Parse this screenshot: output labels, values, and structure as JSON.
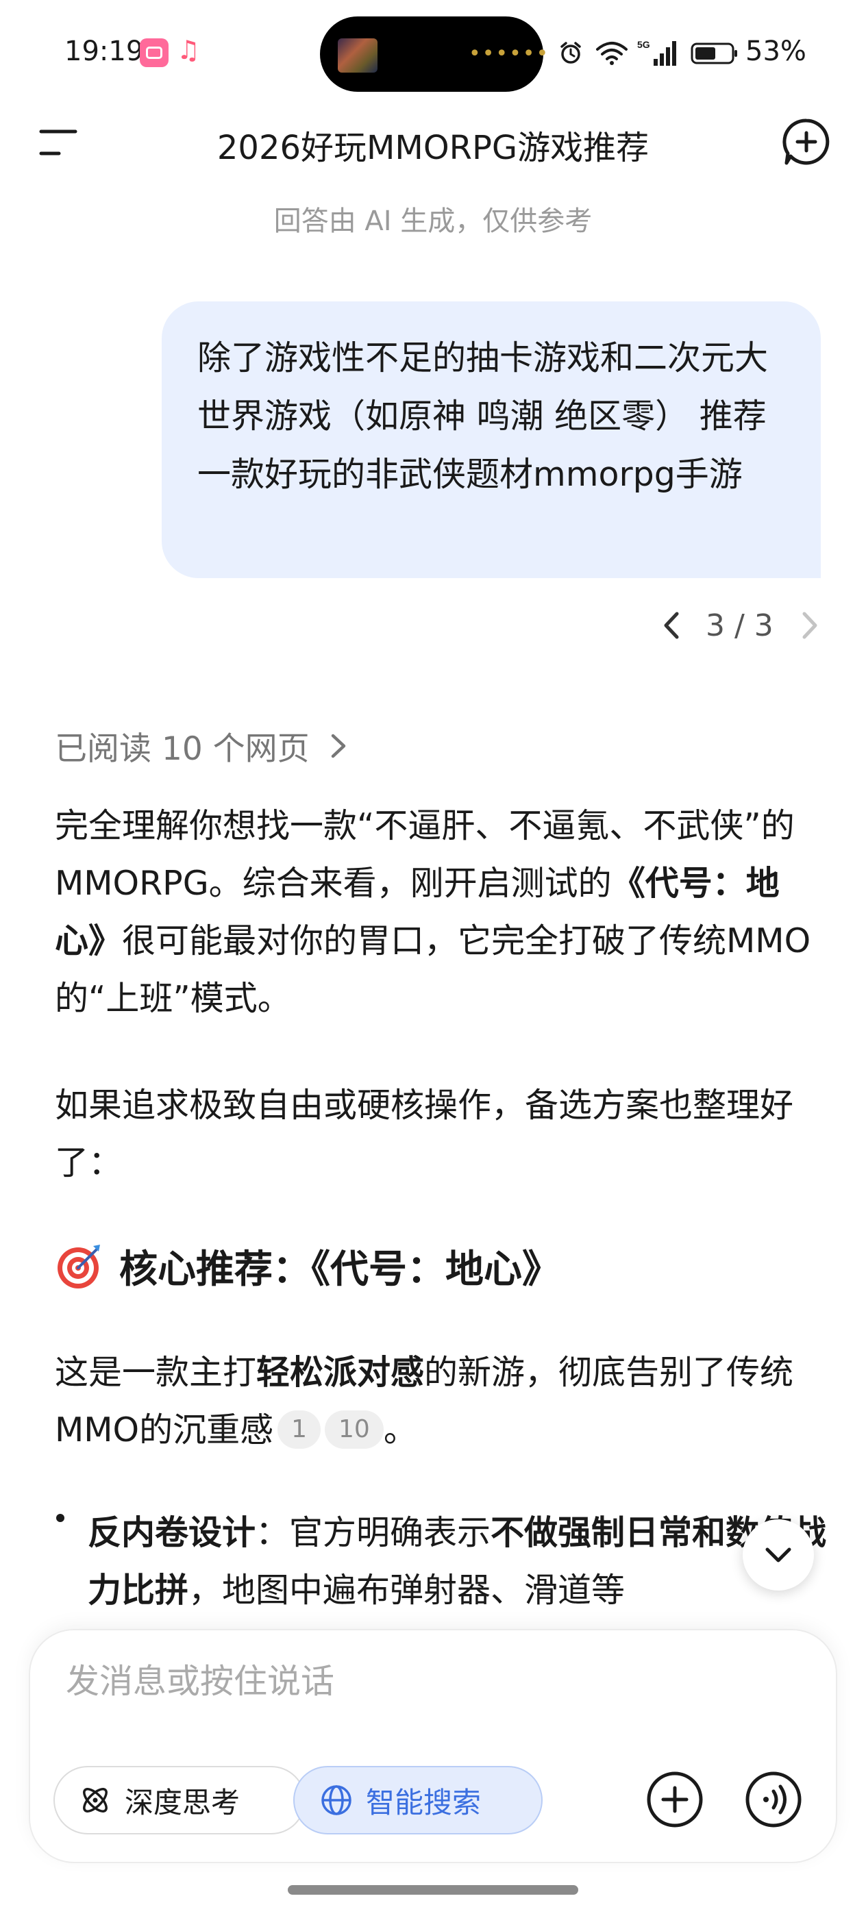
{
  "status_bar": {
    "time": "19:19",
    "battery": "53%",
    "icons": [
      "bilibili-app-icon",
      "music-icon",
      "alarm-icon",
      "wifi-icon",
      "signal-5g-icon",
      "battery-icon"
    ]
  },
  "header": {
    "title": "2026好玩MMORPG游戏推荐",
    "disclaimer": "回答由 AI 生成，仅供参考"
  },
  "user_message": {
    "text": "除了游戏性不足的抽卡游戏和二次元大世界游戏（如原神 鸣潮 绝区零） 推荐一款好玩的非武侠题材mmorpg手游"
  },
  "pager": {
    "label": "3 / 3"
  },
  "answer": {
    "sources_label": "已阅读 10 个网页",
    "para1": {
      "a": "完全理解你想找一款“不逼肝、不逼氪、不武侠”的MMORPG。综合来看，刚开启测试的",
      "b": "《代号：地心》",
      "c": "很可能最对你的胃口，它完全打破了传统MMO的“上班”模式。"
    },
    "para2": "如果追求极致自由或硬核操作，备选方案也整理好了：",
    "section_heading": "核心推荐：《代号：地心》",
    "para3": {
      "a": "这是一款主打",
      "b": "轻松派对感",
      "c": "的新游，彻底告别了传统MMO的沉重感",
      "cite1": "1",
      "cite2": "10",
      "d": "。"
    },
    "bullet1": {
      "title": "反内卷设计",
      "a": "：官方明确表示",
      "b": "不做强制日常和数值战力比拼",
      "c": "，地图中遍布弹射器、滑道等"
    }
  },
  "input": {
    "placeholder": "发消息或按住说话",
    "deep_think_label": "深度思考",
    "smart_search_label": "智能搜索"
  },
  "colors": {
    "bubble": "#e9f0fe",
    "accent": "#3b6fe0",
    "accent_bg": "#e4ecfd",
    "muted_text": "#9a9a9a"
  }
}
